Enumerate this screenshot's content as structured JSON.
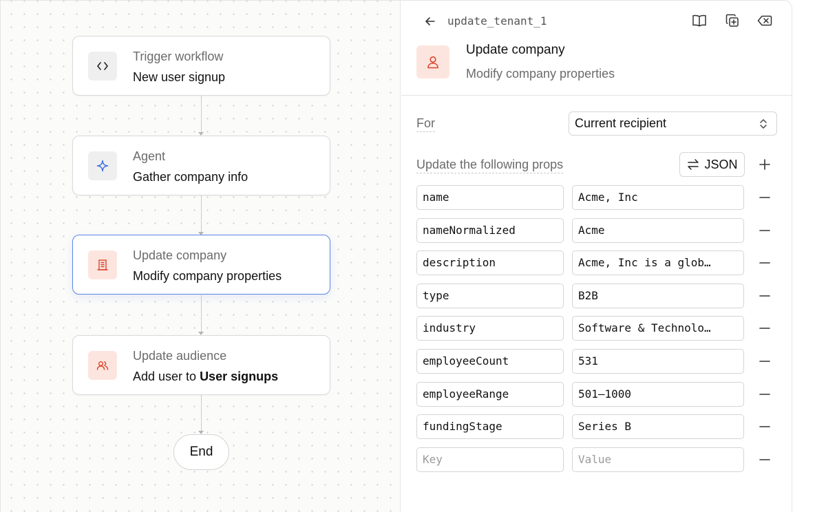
{
  "workflow": {
    "nodes": [
      {
        "title": "Trigger workflow",
        "subtitle": "New user signup",
        "icon": "code-icon"
      },
      {
        "title": "Agent",
        "subtitle": "Gather company info",
        "icon": "sparkle-icon"
      },
      {
        "title": "Update company",
        "subtitle": "Modify company properties",
        "icon": "building-icon",
        "selected": true
      },
      {
        "title": "Update audience",
        "subtitle_prefix": "Add user to ",
        "subtitle_bold": "User signups",
        "icon": "users-icon"
      }
    ],
    "end_label": "End"
  },
  "panel": {
    "step_id": "update_tenant_1",
    "title": "Update company",
    "subtitle": "Modify company properties",
    "header_icons": [
      "back-arrow-icon",
      "book-icon",
      "duplicate-icon",
      "delete-icon"
    ],
    "for_label": "For",
    "for_value": "Current recipient",
    "props_label": "Update the following props",
    "json_button": "JSON",
    "props": [
      {
        "key": "name",
        "value": "Acme, Inc"
      },
      {
        "key": "nameNormalized",
        "value": "Acme"
      },
      {
        "key": "description",
        "value": "Acme, Inc is a glob…"
      },
      {
        "key": "type",
        "value": "B2B"
      },
      {
        "key": "industry",
        "value": "Software & Technolo…"
      },
      {
        "key": "employeeCount",
        "value": "531"
      },
      {
        "key": "employeeRange",
        "value": "501–1000"
      },
      {
        "key": "fundingStage",
        "value": "Series B"
      }
    ],
    "empty_row": {
      "key_placeholder": "Key",
      "value_placeholder": "Value"
    }
  },
  "colors": {
    "accent_orange": "#d9452a",
    "accent_blue": "#3b6fe0",
    "selected_border": "#5b86e5"
  }
}
